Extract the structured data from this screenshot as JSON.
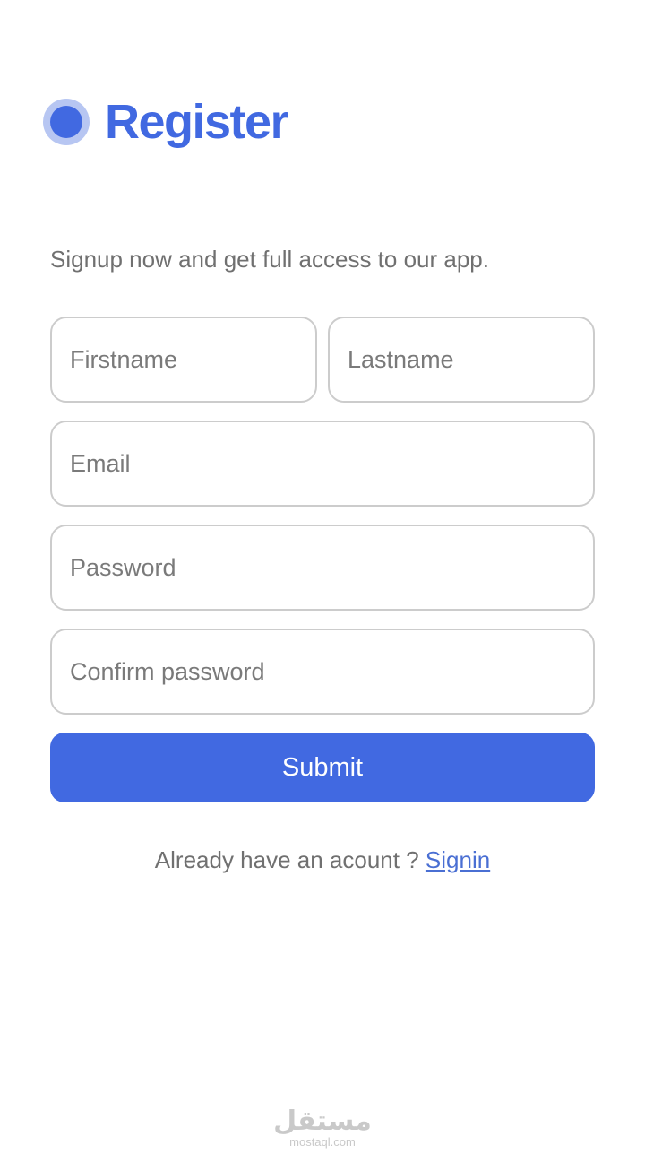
{
  "header": {
    "title": "Register",
    "icon": "logo-circle-icon",
    "accent_color": "#4169e1"
  },
  "subtitle": "Signup now and get full access to our app.",
  "form": {
    "firstname_placeholder": "Firstname",
    "lastname_placeholder": "Lastname",
    "email_placeholder": "Email",
    "password_placeholder": "Password",
    "confirm_password_placeholder": "Confirm password",
    "submit_label": "Submit"
  },
  "footer": {
    "prompt": "Already have an acount ? ",
    "signin_label": "Signin"
  },
  "watermark": {
    "main": "مستقل",
    "sub": "mostaql.com"
  }
}
